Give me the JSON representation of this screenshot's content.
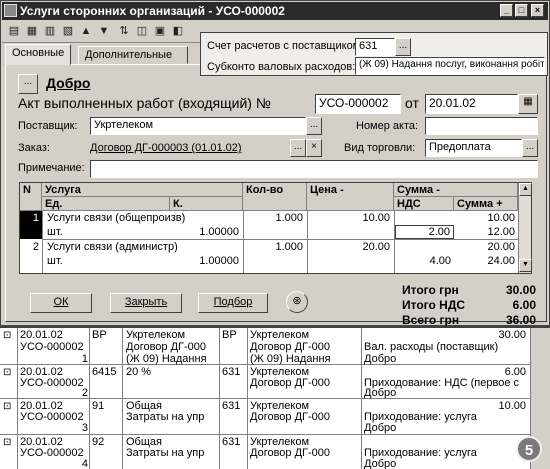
{
  "window": {
    "title": "Услуги сторонних организаций - УСО-000002"
  },
  "tabs": [
    {
      "label": "Основные"
    },
    {
      "label": "Дополнительные"
    }
  ],
  "tooltip": {
    "account_label": "Счет расчетов с поставщиком:",
    "account_value": "631",
    "subconto_label": "Субконто валовых расходов:",
    "subconto_value": "(Ж 09) Надання послуг, виконання робіт"
  },
  "header": {
    "dobro": "Добро",
    "doc_title": "Акт выполненных работ (входящий) №",
    "doc_number": "УСО-000002",
    "from_label": "от",
    "doc_date": "20.01.02",
    "supplier_label": "Поставщик:",
    "supplier_value": "Укртелеком",
    "act_number_label": "Номер акта:",
    "act_number_value": "",
    "contract_label": "Заказ:",
    "contract_value": "Договор ДГ-000003 (01.01.02)",
    "trade_type_label": "Вид торговли:",
    "trade_type_value": "Предоплата",
    "note_label": "Примечание:",
    "note_value": ""
  },
  "grid": {
    "headers": {
      "n": "N",
      "service": "Услуга",
      "unit": "Ед.",
      "k": "К.",
      "qty": "Кол-во",
      "price": "Цена -",
      "sum": "Сумма -",
      "vat": "НДС",
      "sum_plus": "Сумма +"
    },
    "rows": [
      {
        "n": "1",
        "service": "Услуги связи (общепроизв)",
        "unit": "шт.",
        "k": "1.00000",
        "qty": "1.000",
        "price": "10.00",
        "vat": "2.00",
        "sum_minus": "10.00",
        "sum_plus": "12.00"
      },
      {
        "n": "2",
        "service": "Услуги связи (администр)",
        "unit": "шт.",
        "k": "1.00000",
        "qty": "1.000",
        "price": "20.00",
        "vat": "4.00",
        "sum_minus": "20.00",
        "sum_plus": "24.00"
      }
    ]
  },
  "buttons": {
    "ok": "ОК",
    "close": "Закрыть",
    "select": "Подбор"
  },
  "totals": {
    "total_label": "Итого грн",
    "total_value": "30.00",
    "vat_label": "Итого НДС",
    "vat_value": "6.00",
    "all_label": "Всего грн",
    "all_value": "36.00"
  },
  "journal": {
    "rows": [
      {
        "date": "20.01.02",
        "doc": "УСО-000002",
        "n": "1",
        "dt": "ВР",
        "dt_sub": [
          "Укртелеком",
          "Договор ДГ-000",
          "(Ж 09) Надання"
        ],
        "kt": "ВР",
        "kt_sub": [
          "Укртелеком",
          "Договор ДГ-000",
          "(Ж 09) Надання"
        ],
        "desc": [
          "Вал. расходы (поставщик)",
          "Добро"
        ],
        "amount": "30.00"
      },
      {
        "date": "20.01.02",
        "doc": "УСО-000002",
        "n": "2",
        "dt": "6415",
        "dt_sub": [
          "20 %"
        ],
        "kt": "631",
        "kt_sub": [
          "Укртелеком",
          "Договор ДГ-000"
        ],
        "desc": [
          "Приходование: НДС (первое с",
          "Добро"
        ],
        "amount": "6.00"
      },
      {
        "date": "20.01.02",
        "doc": "УСО-000002",
        "n": "3",
        "dt": "91",
        "dt_sub": [
          "Общая",
          "Затраты на упр"
        ],
        "kt": "631",
        "kt_sub": [
          "Укртелеком",
          "Договор ДГ-000"
        ],
        "desc": [
          "Приходование: услуга",
          "Добро"
        ],
        "amount": "10.00"
      },
      {
        "date": "20.01.02",
        "doc": "УСО-000002",
        "n": "4",
        "dt": "92",
        "dt_sub": [
          "Общая",
          "Затраты на упр"
        ],
        "kt": "631",
        "kt_sub": [
          "Укртелеком",
          "Договор ДГ-000"
        ],
        "desc": [
          "Приходование: услуга",
          "Добро"
        ],
        "amount": ""
      }
    ]
  },
  "badge": "5"
}
